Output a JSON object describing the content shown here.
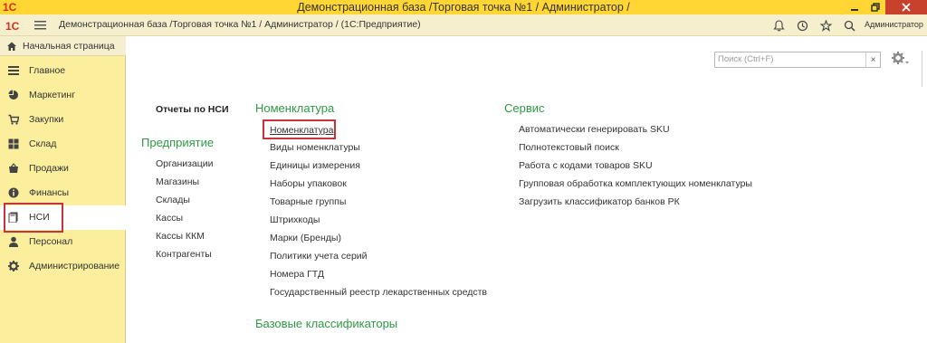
{
  "window": {
    "title": "Демонстрационная база /Торговая точка №1 / Администратор /"
  },
  "toolbar": {
    "path": "Демонстрационная база /Торговая точка №1 / Администратор /  (1С:Предприятие)",
    "user": "Администратор"
  },
  "sidebar": {
    "home": "Начальная страница",
    "items": [
      {
        "label": "Главное",
        "icon": "list-icon"
      },
      {
        "label": "Маркетинг",
        "icon": "pie-icon"
      },
      {
        "label": "Закупки",
        "icon": "basket-icon"
      },
      {
        "label": "Склад",
        "icon": "grid-icon"
      },
      {
        "label": "Продажи",
        "icon": "cart-icon"
      },
      {
        "label": "Финансы",
        "icon": "info-circle-icon"
      },
      {
        "label": "НСИ",
        "icon": "book-icon"
      },
      {
        "label": "Персонал",
        "icon": "person-icon"
      },
      {
        "label": "Администрирование",
        "icon": "gear-icon"
      }
    ],
    "active": "НСИ"
  },
  "search": {
    "placeholder": "Поиск (Ctrl+F)",
    "clear": "×"
  },
  "col1": {
    "reports": "Отчеты по НСИ",
    "group_title": "Предприятие",
    "items": [
      "Организации",
      "Магазины",
      "Склады",
      "Кассы",
      "Кассы ККМ",
      "Контрагенты"
    ]
  },
  "col2": {
    "group_title": "Номенклатура",
    "items": [
      "Номенклатура",
      "Виды номенклатуры",
      "Единицы измерения",
      "Наборы упаковок",
      "Товарные группы",
      "Штрихкоды",
      "Марки (Бренды)",
      "Политики учета серий",
      "Номера ГТД",
      "Государственный реестр лекарственных средств"
    ],
    "group2_title": "Базовые классификаторы"
  },
  "col3": {
    "group_title": "Сервис",
    "items": [
      "Автоматически генерировать SKU",
      "Полнотекстовый поиск",
      "Работа с кодами товаров SKU",
      "Групповая обработка комплектующих номенклатуры",
      "Загрузить классификатор банков РК"
    ]
  },
  "colors": {
    "accent_yellow": "#ffd633",
    "sidebar_bg": "#fbee9d",
    "group_green": "#2e9a45",
    "highlight_red": "#c8323c"
  }
}
